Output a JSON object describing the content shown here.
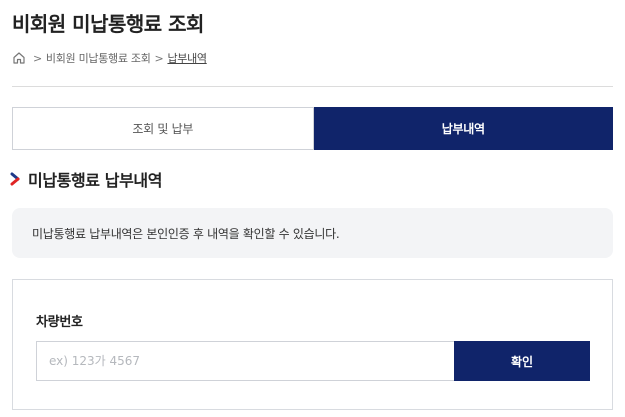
{
  "page": {
    "title": "비회원 미납통행료 조회"
  },
  "breadcrumb": {
    "home_icon": "home-icon",
    "items": [
      "비회원 미납통행료 조회",
      "납부내역"
    ],
    "separator": ">"
  },
  "tabs": [
    {
      "label": "조회 및 납부",
      "active": false
    },
    {
      "label": "납부내역",
      "active": true
    }
  ],
  "section": {
    "title": "미납통행료 납부내역",
    "icon": "chevron-right-icon"
  },
  "info": {
    "text": "미납통행료 납부내역은 본인인증 후 내역을 확인할 수 있습니다."
  },
  "form": {
    "label": "차량번호",
    "placeholder": "ex) 123가 4567",
    "value": "",
    "button_label": "확인"
  },
  "colors": {
    "accent": "#10246a",
    "chevron_blue": "#1e3a8a",
    "chevron_red": "#e02424",
    "info_bg": "#f3f4f6"
  }
}
